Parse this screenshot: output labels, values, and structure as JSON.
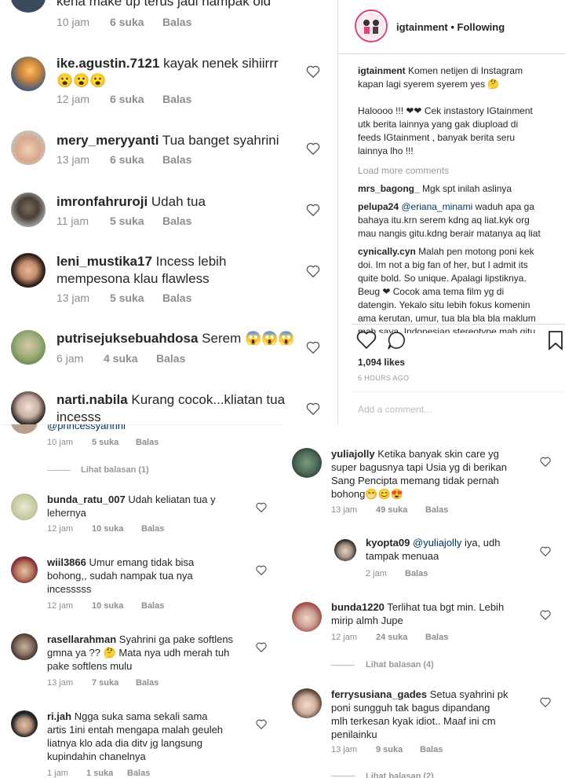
{
  "top_panel": {
    "partial": {
      "text": "kena make up terus jadi nampak old",
      "time": "10 jam",
      "likes": "6 suka",
      "reply": "Balas"
    },
    "comments": [
      {
        "user": "ike.agustin.7121",
        "text": "kayak nenek sihiirrr",
        "emoji": "😮😮😮",
        "time": "12 jam",
        "likes": "6 suka",
        "reply": "Balas"
      },
      {
        "user": "mery_meryyanti",
        "text": "Tua banget syahrini",
        "time": "13 jam",
        "likes": "6 suka",
        "reply": "Balas"
      },
      {
        "user": "imronfahruroji",
        "text": "Udah tua",
        "time": "11 jam",
        "likes": "5 suka",
        "reply": "Balas"
      },
      {
        "user": "leni_mustika17",
        "text": "Incess lebih",
        "text2": "mempesona klau flawless",
        "time": "13 jam",
        "likes": "5 suka",
        "reply": "Balas"
      },
      {
        "user": "putrisejuksebuahdosa",
        "text": "Serem",
        "emoji": "😱😱😱",
        "time": "6 jam",
        "likes": "4 suka",
        "reply": "Balas"
      },
      {
        "user": "narti.nabila",
        "text": "Kurang cocok...kliatan tua",
        "text2": "incesss"
      }
    ]
  },
  "ig_post": {
    "account": "igtainment",
    "following": "• Following",
    "caption_user": "igtainment",
    "caption_1": "Komen netijen di Instagram",
    "caption_2": "kapan lagi syerem syerem yes 🤔",
    "caption_3": "Haloooo !!! ❤❤ Cek instastory IGtainment",
    "caption_4": "utk berita lainnya yang gak diupload di",
    "caption_5": "feeds IGtainment , banyak berita seru",
    "caption_6": "lainnya lho !!!",
    "load_more": "Load more comments",
    "c1_user": "mrs_bagong_",
    "c1_text": "Mgk spt inilah aslinya",
    "c2_user": "pelupa24",
    "c2_mention": "@eriana_minami",
    "c2_l1": "waduh apa ga",
    "c2_l2": "bahaya itu.krn serem kdng aq liat.kyk org",
    "c2_l3": "mau nangis gitu.kdng berair matanya aq liat",
    "c3_user": "cynically.cyn",
    "c3_l1": "Malah pen motong poni kek",
    "c3_l2": "doi. Im not a big fan of her, but I admit its",
    "c3_l3": "quite bold. So unique. Apalagi lipstiknya.",
    "c3_l4": "Beug ❤ Cocok ama tema film yg di",
    "c3_l5": "datengin. Yekalo situ lebih fokus komenin",
    "c3_l6": "ama kerutan, umur, tua bla bla bla maklum",
    "c3_l7": "mah saya. Indonesian stereotype mah gitu",
    "likes": "1,094 likes",
    "time_ago": "6 HOURS AGO",
    "add_comment_placeholder": "Add a comment..."
  },
  "bottom_left": {
    "partial_user": "@princessyahrini",
    "partial_time": "10 jam",
    "partial_likes": "5 suka",
    "partial_reply": "Balas",
    "view_replies": "Lihat balasan (1)",
    "comments": [
      {
        "user": "bunda_ratu_007",
        "l1": "Udah keliatan tua y",
        "l2": "lehernya",
        "time": "12 jam",
        "likes": "10 suka",
        "reply": "Balas"
      },
      {
        "user": "wiil3866",
        "l1": "Umur emang tidak bisa",
        "l2": "bohong,, sudah nampak tua nya",
        "l3": "incesssss",
        "time": "12 jam",
        "likes": "10 suka",
        "reply": "Balas"
      },
      {
        "user": "rasellarahman",
        "l1": "Syahrini ga pake softlens",
        "l2": "gmna ya ??",
        "l2b": "Mata nya udh merah tuh",
        "l3": "pake softlens mulu",
        "time": "13 jam",
        "likes": "7 suka",
        "reply": "Balas"
      },
      {
        "user": "ri.jah",
        "l1": "Ngga suka sama sekali sama",
        "l2": "artis 1ini entah mengapa malah geuleh",
        "l3": "liatnya klo ada dia ditv jg langsung",
        "l4": "kupindahin chanelnya",
        "time": "1 jam",
        "likes": "1 suka",
        "reply": "Balas"
      }
    ]
  },
  "bottom_right": {
    "comments": [
      {
        "user": "yuliajolly",
        "l1": "Ketika banyak skin care yg",
        "l2": "super bagusnya tapi Usia yg di berikan",
        "l3": "Sang Pencipta memang tidak pernah",
        "l4": "bohong",
        "emoji": "😁😊😍",
        "time": "13 jam",
        "likes": "49 suka",
        "reply": "Balas"
      },
      {
        "user": "kyopta09",
        "mention": "@yuliajolly",
        "l1": "iya, udh",
        "l2": "tampak menuaa",
        "time": "2 jam",
        "reply": "Balas"
      },
      {
        "user": "bunda1220",
        "l1": "Terlihat tua bgt min. Lebih",
        "l2": "mirip almh Jupe",
        "time": "12 jam",
        "likes": "24 suka",
        "reply": "Balas"
      },
      {
        "user": "ferrysusiana_gades",
        "l1": "Setua syahrini pk",
        "l2": "poni sungguh tak bagus dipandang",
        "l3": "mlh terkesan kyak idiot.. Maaf ini cm",
        "l4": "penilainku",
        "time": "13 jam",
        "likes": "9 suka",
        "reply": "Balas"
      }
    ],
    "view_replies": "Lihat balasan (4)",
    "partial_replies": "Lihat balasan (2)"
  }
}
